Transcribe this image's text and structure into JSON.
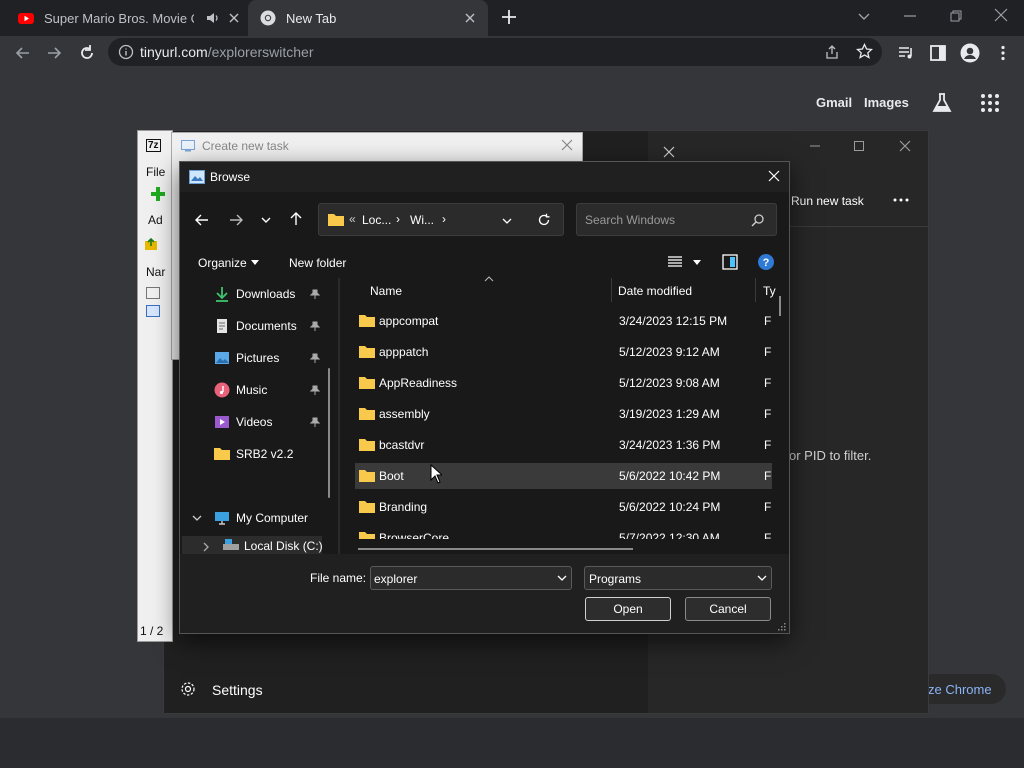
{
  "chrome": {
    "tabs": [
      {
        "title": "Super Mario Bros. Movie Cha"
      },
      {
        "title": "New Tab"
      }
    ],
    "url_host": "tinyurl.com",
    "url_path": "/explorerswitcher",
    "ntp_links": {
      "gmail": "Gmail",
      "images": "Images"
    },
    "customize": "ze Chrome"
  },
  "taskmgr": {
    "run_new_task": "Run new task",
    "filter_hint": "or PID to filter.",
    "settings": "Settings"
  },
  "sevenzip": {
    "title_glyph": "7z",
    "menu_file": "File",
    "add_label": "Ad",
    "name_col": "Nar",
    "page": "1 / 2"
  },
  "create_task": {
    "title": "Create new task"
  },
  "browse": {
    "title": "Browse",
    "breadcrumb": [
      "Loc...",
      "Wi..."
    ],
    "breadcrumb_prefix": "«",
    "search_placeholder": "Search Windows",
    "organize": "Organize",
    "new_folder": "New folder",
    "nav": [
      {
        "label": "Downloads",
        "pinned": true
      },
      {
        "label": "Documents",
        "pinned": true
      },
      {
        "label": "Pictures",
        "pinned": true
      },
      {
        "label": "Music",
        "pinned": true
      },
      {
        "label": "Videos",
        "pinned": true
      },
      {
        "label": "SRB2 v2.2",
        "pinned": false
      }
    ],
    "my_computer": "My Computer",
    "local_disk": "Local Disk (C:)",
    "columns": {
      "name": "Name",
      "date": "Date modified",
      "type": "Ty"
    },
    "files": [
      {
        "name": "appcompat",
        "date": "3/24/2023 12:15 PM",
        "type": "Fi"
      },
      {
        "name": "apppatch",
        "date": "5/12/2023 9:12 AM",
        "type": "Fi"
      },
      {
        "name": "AppReadiness",
        "date": "5/12/2023 9:08 AM",
        "type": "Fi"
      },
      {
        "name": "assembly",
        "date": "3/19/2023 1:29 AM",
        "type": "Fi"
      },
      {
        "name": "bcastdvr",
        "date": "3/24/2023 1:36 PM",
        "type": "Fi"
      },
      {
        "name": "Boot",
        "date": "5/6/2022 10:42 PM",
        "type": "Fi"
      },
      {
        "name": "Branding",
        "date": "5/6/2022 10:24 PM",
        "type": "Fi"
      },
      {
        "name": "BrowserCore",
        "date": "5/7/2022 12:30 AM",
        "type": "Fi"
      }
    ],
    "file_name_label": "File name:",
    "file_name_value": "explorer",
    "file_type": "Programs",
    "open": "Open",
    "cancel": "Cancel"
  },
  "colors": {
    "folder": "#f8c94a",
    "accent": "#4cc2ff",
    "selected_row": "#3a3a3a"
  }
}
